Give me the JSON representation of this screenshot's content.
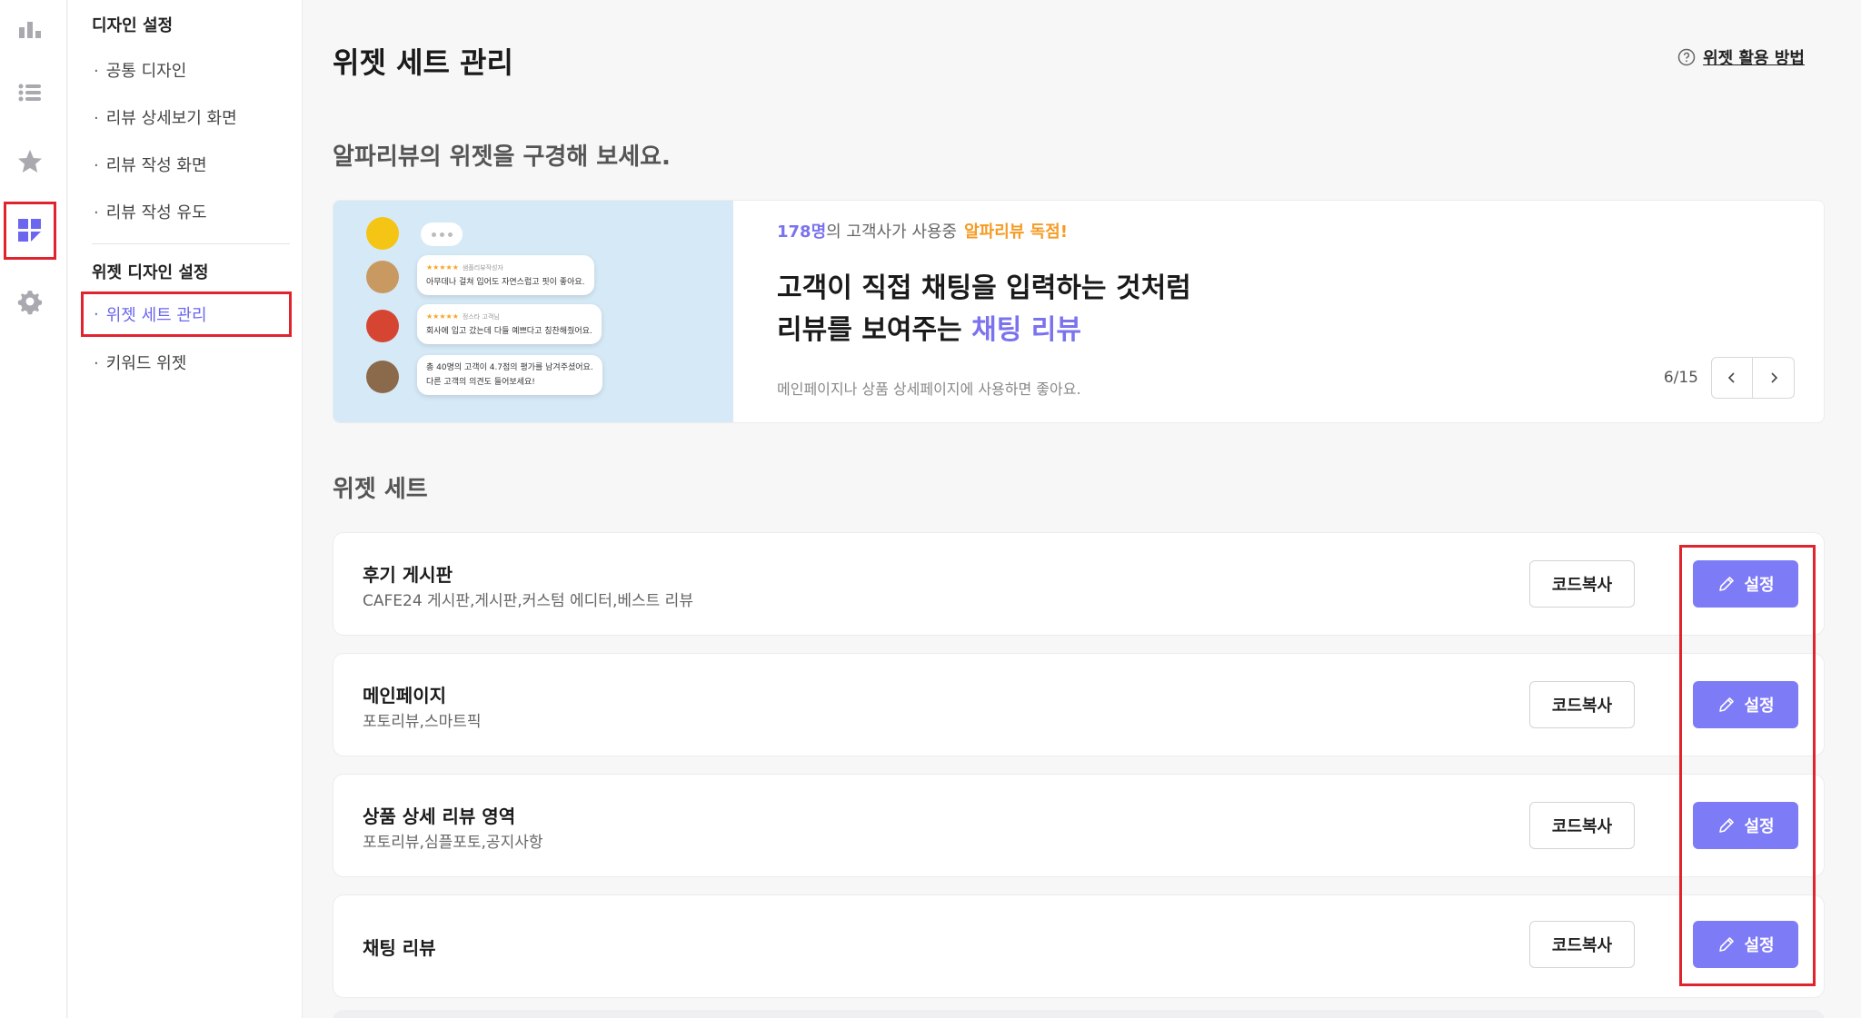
{
  "rail": {
    "items": [
      {
        "icon": "bar-chart-icon"
      },
      {
        "icon": "list-icon"
      },
      {
        "icon": "star-icon"
      },
      {
        "icon": "widget-grid-icon",
        "active": true
      },
      {
        "icon": "gear-icon"
      }
    ]
  },
  "submenu": {
    "group1_title": "디자인 설정",
    "group1_items": [
      "공통 디자인",
      "리뷰 상세보기 화면",
      "리뷰 작성 화면",
      "리뷰 작성 유도"
    ],
    "group2_title": "위젯 디자인 설정",
    "group2_items": [
      "위젯 세트 관리",
      "키워드 위젯"
    ],
    "bullet": "·"
  },
  "header": {
    "title": "위젯 세트 관리",
    "help_link": "위젯 활용 방법"
  },
  "subheading": "알파리뷰의 위젯을 구경해 보세요.",
  "banner": {
    "count": "178명",
    "count_suffix": "의 고객사가 사용중",
    "promo": "알파리뷰 독점!",
    "headline_line1": "고객이 직접 채팅을 입력하는 것처럼",
    "headline_line2_prefix": "리뷰를 보여주는 ",
    "headline_line2_accent": "채팅 리뷰",
    "caption": "메인페이지나 상품 상세페이지에 사용하면 좋아요.",
    "pager": "6/15",
    "bubbles": [
      {
        "stars": "★★★★★",
        "meta": "샘플리뷰작성자",
        "text": "아무데나 걸쳐 입어도 자연스럽고 핏이 좋아요."
      },
      {
        "stars": "★★★★★",
        "meta": "정스타 고객님",
        "text": "회사에 입고 갔는데 다들 예쁘다고 칭찬해줬어요."
      },
      {
        "text": "총 40명의 고객이 4.7점의 평가를 남겨주셨어요.",
        "text2": "다른 고객의 의견도 들어보세요!"
      }
    ]
  },
  "section_title": "위젯 세트",
  "widgets": [
    {
      "title": "후기 게시판",
      "subtitle": "CAFE24 게시판,게시판,커스텀 에디터,베스트 리뷰",
      "copy_label": "코드복사",
      "settings_label": "설정"
    },
    {
      "title": "메인페이지",
      "subtitle": "포토리뷰,스마트픽",
      "copy_label": "코드복사",
      "settings_label": "설정"
    },
    {
      "title": "상품 상세 리뷰 영역",
      "subtitle": "포토리뷰,심플포토,공지사항",
      "copy_label": "코드복사",
      "settings_label": "설정"
    },
    {
      "title": "채팅 리뷰",
      "subtitle": "",
      "copy_label": "코드복사",
      "settings_label": "설정"
    }
  ],
  "colors": {
    "accent": "#7e7bf7",
    "highlight": "#e0242e",
    "promo": "#f59b23",
    "active_menu": "#6b66f0"
  }
}
